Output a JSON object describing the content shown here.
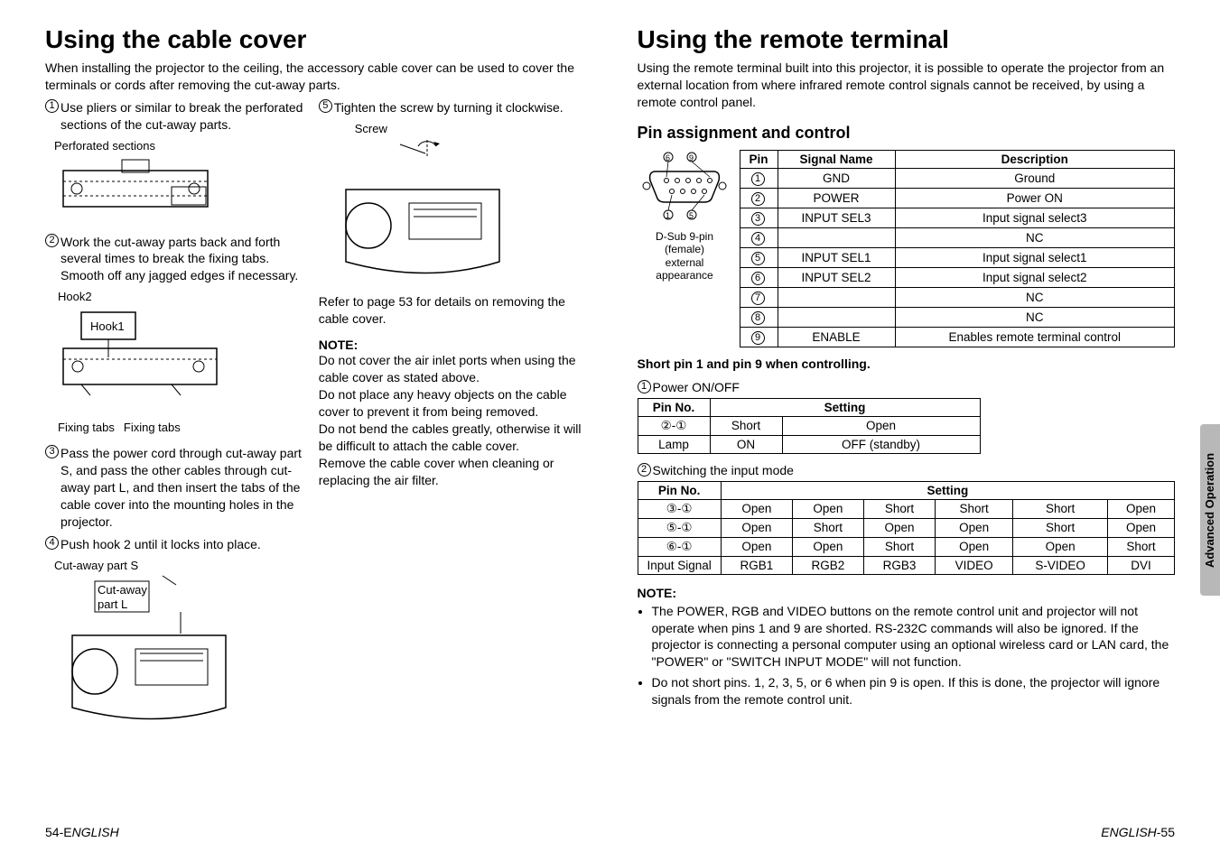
{
  "left": {
    "title": "Using the cable cover",
    "intro": "When installing the projector to the ceiling, the accessory cable cover can be used to cover the terminals or cords after removing the cut-away parts.",
    "steps_col1": [
      {
        "n": "1",
        "text": "Use pliers or similar to break the perforated sections of the cut-away parts."
      },
      {
        "n": "2",
        "text": "Work the cut-away parts back and forth several times to break the fixing tabs. Smooth off any jagged edges if necessary."
      },
      {
        "n": "3",
        "text": "Pass the power cord through cut-away part S, and pass the other cables through cut-away part L, and then insert the tabs of the cable cover into the mounting holes in the projector."
      },
      {
        "n": "4",
        "text": "Push hook 2 until it locks into place."
      }
    ],
    "steps_col2": [
      {
        "n": "5",
        "text": "Tighten the screw by turning it clockwise."
      }
    ],
    "captions": {
      "perforated": "Perforated sections",
      "hook2": "Hook2",
      "hook1": "Hook1",
      "fixingtabs1": "Fixing tabs",
      "fixingtabs2": "Fixing tabs",
      "cutawayS": "Cut-away part S",
      "cutawayL": "Cut-away part L",
      "screw": "Screw"
    },
    "ref_text": "Refer to page 53 for details on removing the cable cover.",
    "note_head": "NOTE:",
    "note_lines": [
      "Do not cover the air inlet ports when using the cable cover as stated above.",
      "Do not place any heavy objects on the cable cover to prevent it from being removed.",
      "Do not bend the cables greatly, otherwise it will be difficult to attach the cable cover.",
      "Remove the cable cover when cleaning or replacing the air filter."
    ],
    "footer": "54-ENGLISH"
  },
  "right": {
    "title": "Using the remote terminal",
    "intro": "Using the remote terminal built into this projector, it is possible to operate the projector from an external location from where infrared remote control signals cannot be received, by using a remote control panel.",
    "h2": "Pin assignment and control",
    "connector_label1": "D-Sub 9-pin (female)",
    "connector_label2": "external appearance",
    "pin_table": {
      "header": [
        "Pin",
        "Signal Name",
        "Description"
      ],
      "rows": [
        [
          "1",
          "GND",
          "Ground"
        ],
        [
          "2",
          "POWER",
          "Power ON"
        ],
        [
          "3",
          "INPUT SEL3",
          "Input signal select3"
        ],
        [
          "4",
          "",
          "NC"
        ],
        [
          "5",
          "INPUT SEL1",
          "Input signal select1"
        ],
        [
          "6",
          "INPUT SEL2",
          "Input signal select2"
        ],
        [
          "7",
          "",
          "NC"
        ],
        [
          "8",
          "",
          "NC"
        ],
        [
          "9",
          "ENABLE",
          "Enables remote terminal control"
        ]
      ]
    },
    "short_note": "Short pin 1 and pin 9 when controlling.",
    "sub1": {
      "n": "1",
      "label": "Power ON/OFF"
    },
    "power_table": {
      "header": [
        "Pin No.",
        "Setting"
      ],
      "rows": [
        [
          "②-①",
          "Short",
          "Open"
        ],
        [
          "Lamp",
          "ON",
          "OFF (standby)"
        ]
      ]
    },
    "sub2": {
      "n": "2",
      "label": "Switching the input mode"
    },
    "input_table": {
      "header": [
        "Pin No.",
        "Setting"
      ],
      "rows": [
        [
          "③-①",
          "Open",
          "Open",
          "Short",
          "Short",
          "Short",
          "Open"
        ],
        [
          "⑤-①",
          "Open",
          "Short",
          "Open",
          "Open",
          "Short",
          "Open"
        ],
        [
          "⑥-①",
          "Open",
          "Open",
          "Short",
          "Open",
          "Open",
          "Short"
        ],
        [
          "Input Signal",
          "RGB1",
          "RGB2",
          "RGB3",
          "VIDEO",
          "S-VIDEO",
          "DVI"
        ]
      ]
    },
    "note_head": "NOTE:",
    "note_bullets": [
      "The POWER, RGB and VIDEO buttons on the remote control unit and projector will not operate when pins 1 and 9 are shorted. RS-232C commands will also be ignored. If the projector is connecting a personal computer using an optional wireless card or LAN card, the \"POWER\" or \"SWITCH INPUT MODE\" will not function.",
      "Do not short pins. 1, 2, 3, 5, or 6 when pin 9 is open. If this is done, the projector will ignore signals from the remote control unit."
    ],
    "side_tab": "Advanced Operation",
    "footer": "ENGLISH-55"
  }
}
